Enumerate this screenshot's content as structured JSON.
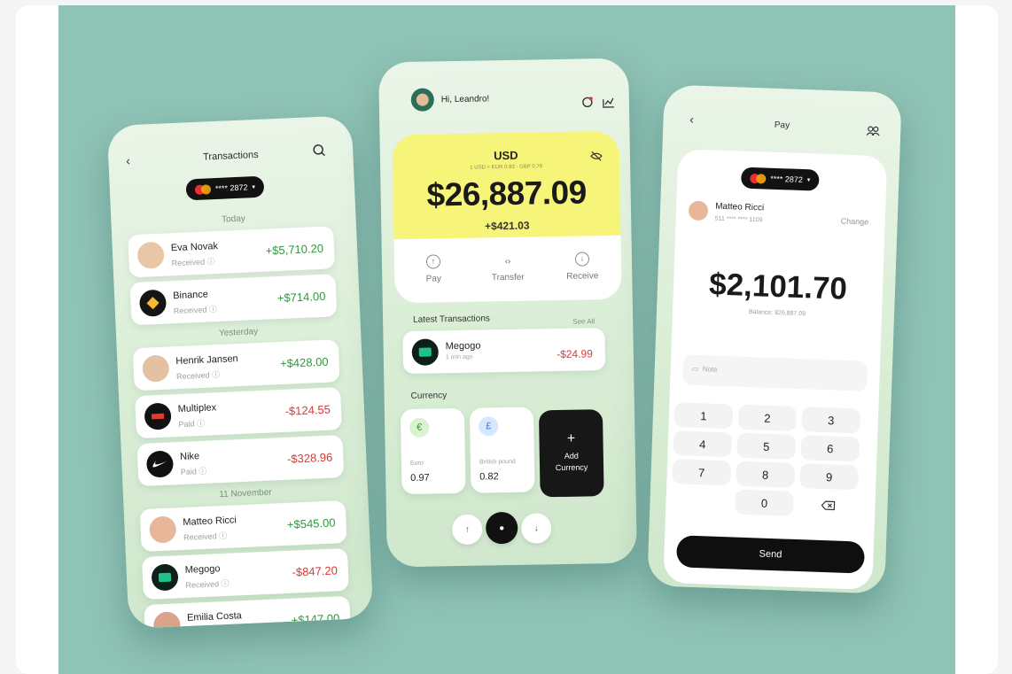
{
  "left": {
    "back_icon": "chevron-left-icon",
    "title": "Transactions",
    "search_icon": "search-icon",
    "card_pill": "**** 2872",
    "groups": [
      "Today",
      "Yesterday",
      "11 November"
    ],
    "transactions": [
      {
        "name": "Eva Novak",
        "status": "Received",
        "amount": "+$5,710.20",
        "sign": "pos",
        "avatar_color": "#e9c7a6"
      },
      {
        "name": "Binance",
        "status": "Received",
        "amount": "+$714.00",
        "sign": "pos",
        "avatar_color": "#151515"
      },
      {
        "name": "Henrik Jansen",
        "status": "Received",
        "amount": "+$428.00",
        "sign": "pos",
        "avatar_color": "#e3c1a2"
      },
      {
        "name": "Multiplex",
        "status": "Paid",
        "amount": "-$124.55",
        "sign": "neg",
        "avatar_color": "#111111"
      },
      {
        "name": "Nike",
        "status": "Paid",
        "amount": "-$328.96",
        "sign": "neg",
        "avatar_color": "#111111"
      },
      {
        "name": "Matteo Ricci",
        "status": "Received",
        "amount": "+$545.00",
        "sign": "pos",
        "avatar_color": "#e8b79a"
      },
      {
        "name": "Megogo",
        "status": "Received",
        "amount": "-$847.20",
        "sign": "neg",
        "avatar_color": "#0d1f1a"
      },
      {
        "name": "Emilia Costa",
        "status": "",
        "amount": "+$147.00",
        "sign": "pos",
        "avatar_color": "#d9a489"
      }
    ]
  },
  "mid": {
    "greeting": "Hi, Leandro!",
    "currency": "USD",
    "rates": "1 USD = EUR 0.93 · GBP 0.79",
    "balance": "$26,887.09",
    "change": "+$421.03",
    "actions": [
      {
        "label": "Pay",
        "icon": "pay-icon"
      },
      {
        "label": "Transfer",
        "icon": "transfer-icon"
      },
      {
        "label": "Receive",
        "icon": "receive-icon"
      }
    ],
    "latest_title": "Latest Transactions",
    "see_all": "See All",
    "latest": {
      "name": "Megogo",
      "time": "1 min ago",
      "amount": "-$24.99"
    },
    "currency_title": "Currency",
    "currencies": [
      {
        "symbol": "€",
        "name": "Euro",
        "value": "0.97",
        "badge_color": "#d9f3d0",
        "symbol_color": "#2b9b3c"
      },
      {
        "symbol": "£",
        "name": "British pound",
        "value": "0.82",
        "badge_color": "#d6e8ff",
        "symbol_color": "#3b6fd8"
      }
    ],
    "add_currency": "Add Currency",
    "add_symbol": "+"
  },
  "right": {
    "title": "Pay",
    "card_pill": "**** 2872",
    "recipient_name": "Matteo Ricci",
    "recipient_account": "511 **** **** 1109",
    "change_label": "Change",
    "amount": "$2,101.70",
    "balance_label": "Balance: $26,887.09",
    "note_placeholder": "Note",
    "keys": [
      "1",
      "2",
      "3",
      "4",
      "5",
      "6",
      "7",
      "8",
      "9",
      "0"
    ],
    "send_label": "Send"
  },
  "colors": {
    "stage": "#8fc3b6",
    "accent_yellow": "#f7f47a",
    "positive": "#2b9b3c",
    "negative": "#d83838"
  }
}
